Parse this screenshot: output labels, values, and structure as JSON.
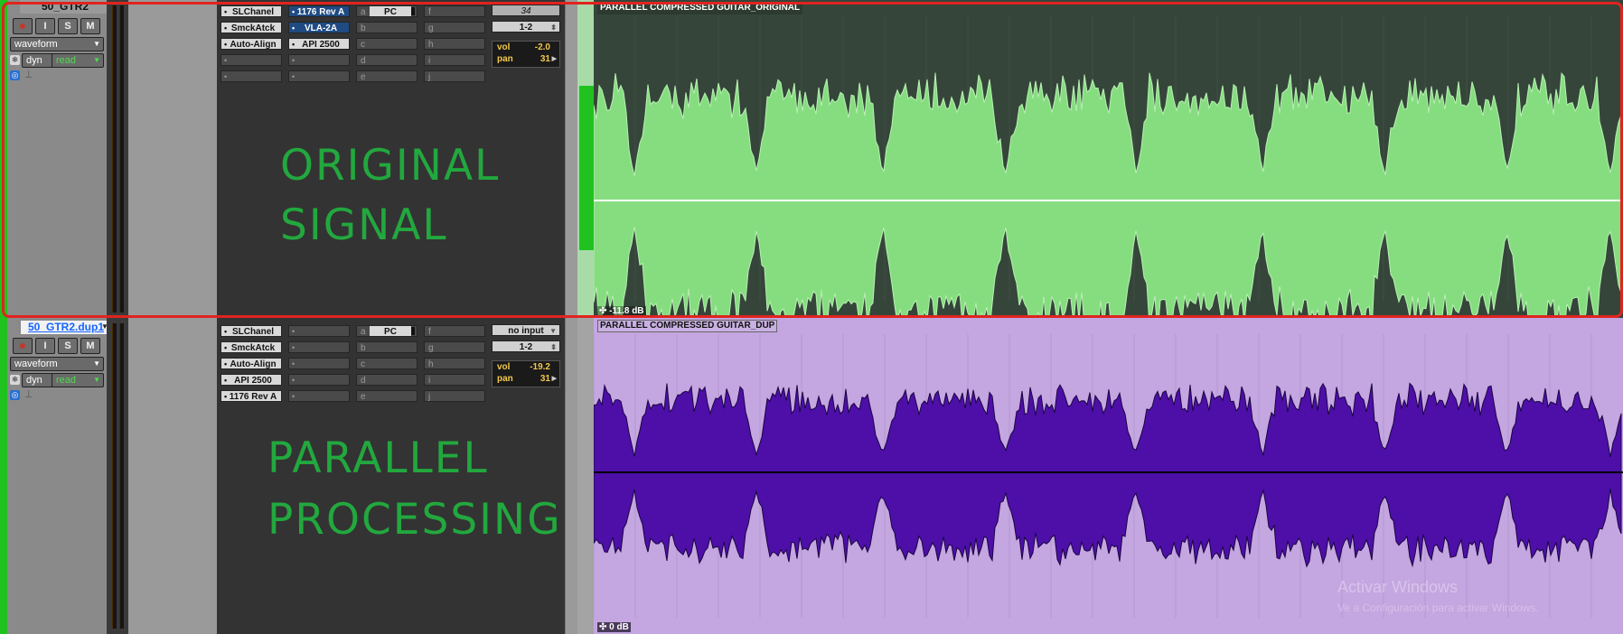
{
  "tracks": [
    {
      "name": "50_GTR2",
      "view": "waveform",
      "automation_mode": "dyn",
      "automation_state": "read",
      "buttons": [
        "●",
        "I",
        "S",
        "M"
      ],
      "inserts_a_e": [
        "SLChanel",
        "SmckAtck",
        "Auto-Align",
        "",
        ""
      ],
      "inserts_f_j": [
        "1176 Rev A",
        "VLA-2A",
        "API 2500",
        "",
        ""
      ],
      "sends_a_e": [
        "PC",
        "b",
        "c",
        "d",
        "e"
      ],
      "sends_f_j": [
        "f",
        "g",
        "h",
        "i",
        "j"
      ],
      "io_input": "34",
      "io_output": "1-2",
      "vol_label": "vol",
      "vol": "-2.0",
      "pan_label": "pan",
      "pan": "31",
      "clip_name": "PARALLEL COMPRESSED GUITAR_ORIGINAL",
      "clip_gain": "-11.8 dB",
      "label_line1": "ORIGINAL",
      "label_line2": "SIGNAL"
    },
    {
      "name": "50_GTR2.dup1",
      "view": "waveform",
      "automation_mode": "dyn",
      "automation_state": "read",
      "buttons": [
        "●",
        "I",
        "S",
        "M"
      ],
      "inserts_a_e": [
        "SLChanel",
        "SmckAtck",
        "Auto-Align",
        "API 2500",
        "1176 Rev A"
      ],
      "inserts_f_j": [
        "",
        "",
        "",
        "",
        ""
      ],
      "sends_a_e": [
        "PC",
        "b",
        "c",
        "d",
        "e"
      ],
      "sends_f_j": [
        "f",
        "g",
        "h",
        "i",
        "j"
      ],
      "io_input": "no input",
      "io_output": "1-2",
      "vol_label": "vol",
      "vol": "-19.2",
      "pan_label": "pan",
      "pan": "31",
      "clip_name": "PARALLEL COMPRESSED GUITAR_DUP",
      "clip_gain": "0 dB",
      "label_line1": "PARALLEL",
      "label_line2": "PROCESSING"
    }
  ],
  "send_prefix": "a",
  "watermark": {
    "line1": "Activar Windows",
    "line2": "Ve a Configuración para activar Windows."
  },
  "colors": {
    "track1_wave": "#86dd80",
    "track1_bg": "#35453a",
    "track2_wave": "#4d0fa8",
    "track2_bg": "#c4a6e0",
    "label_green": "#22a83e",
    "highlight_red": "#e0241f"
  }
}
